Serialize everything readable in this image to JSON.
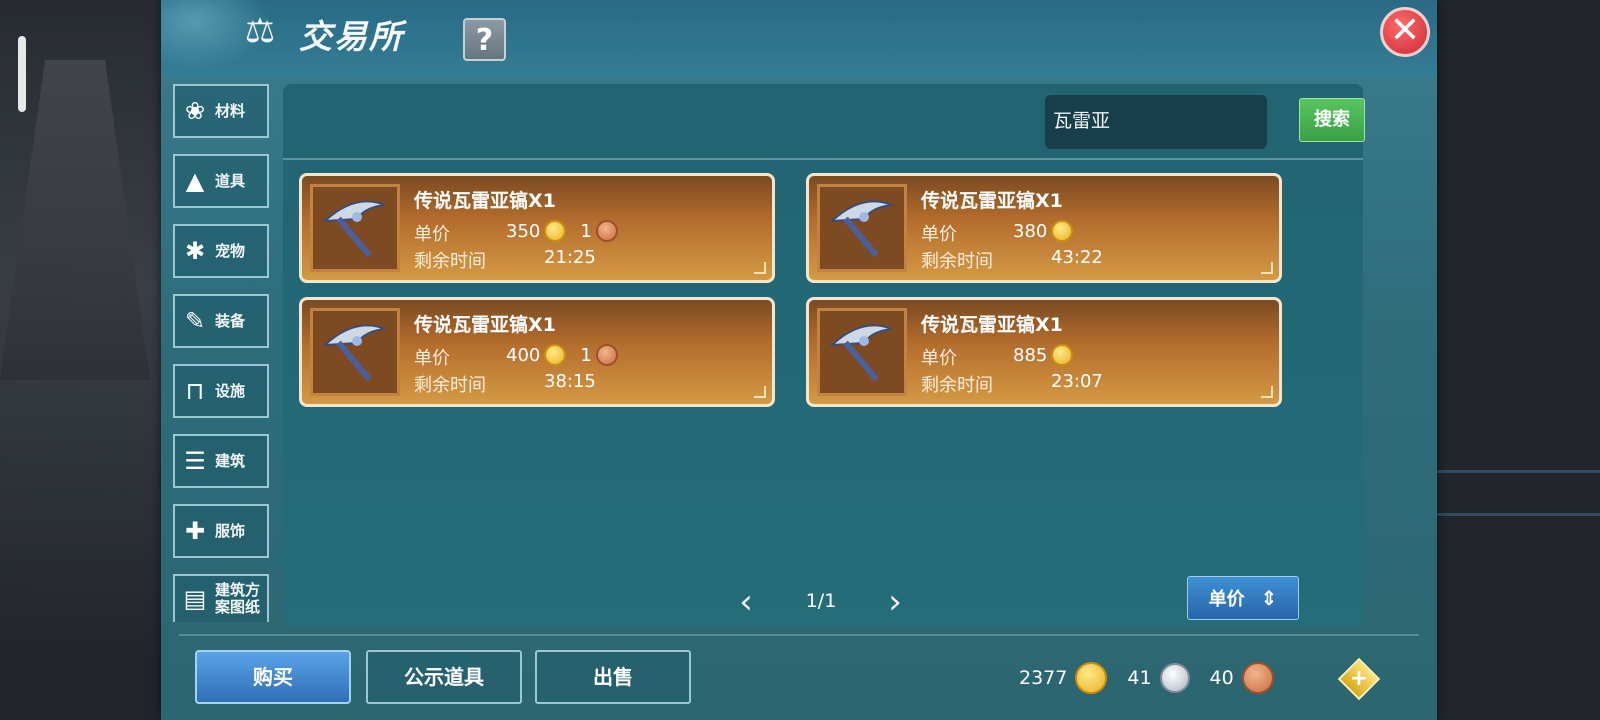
{
  "window": {
    "title": "交易所",
    "help_label": "?",
    "close_label": "✕"
  },
  "categories": [
    {
      "label": "材料",
      "icon": "material-icon",
      "glyph": "❀"
    },
    {
      "label": "道具",
      "icon": "potion-icon",
      "glyph": "▲"
    },
    {
      "label": "宠物",
      "icon": "paw-icon",
      "glyph": "✱"
    },
    {
      "label": "装备",
      "icon": "equipment-icon",
      "glyph": "✎"
    },
    {
      "label": "设施",
      "icon": "facility-icon",
      "glyph": "⊓"
    },
    {
      "label": "建筑",
      "icon": "building-icon",
      "glyph": "☰"
    },
    {
      "label": "服饰",
      "icon": "clothing-icon",
      "glyph": "✚"
    },
    {
      "label": "建筑方\n案图纸",
      "icon": "blueprint-icon",
      "glyph": "▤"
    }
  ],
  "search": {
    "value": "瓦雷亚",
    "button_label": "搜索"
  },
  "listings": [
    {
      "name": "传说瓦雷亚镐X1",
      "price_label": "单价",
      "price": "350",
      "qty": "1",
      "time_label": "剩余时间",
      "time": "21:25"
    },
    {
      "name": "传说瓦雷亚镐X1",
      "price_label": "单价",
      "price": "380",
      "time_label": "剩余时间",
      "time": "43:22"
    },
    {
      "name": "传说瓦雷亚镐X1",
      "price_label": "单价",
      "price": "400",
      "qty": "1",
      "time_label": "剩余时间",
      "time": "38:15"
    },
    {
      "name": "传说瓦雷亚镐X1",
      "price_label": "单价",
      "price": "885",
      "time_label": "剩余时间",
      "time": "23:07"
    }
  ],
  "pagination": {
    "page": "1/1",
    "prev": "‹",
    "next": "›"
  },
  "sort": {
    "label": "单价"
  },
  "actions": {
    "buy": "购买",
    "public": "公示道具",
    "sell": "出售"
  },
  "currency": {
    "gold": "2377",
    "silver": "41",
    "bronze": "40",
    "add": "+"
  }
}
